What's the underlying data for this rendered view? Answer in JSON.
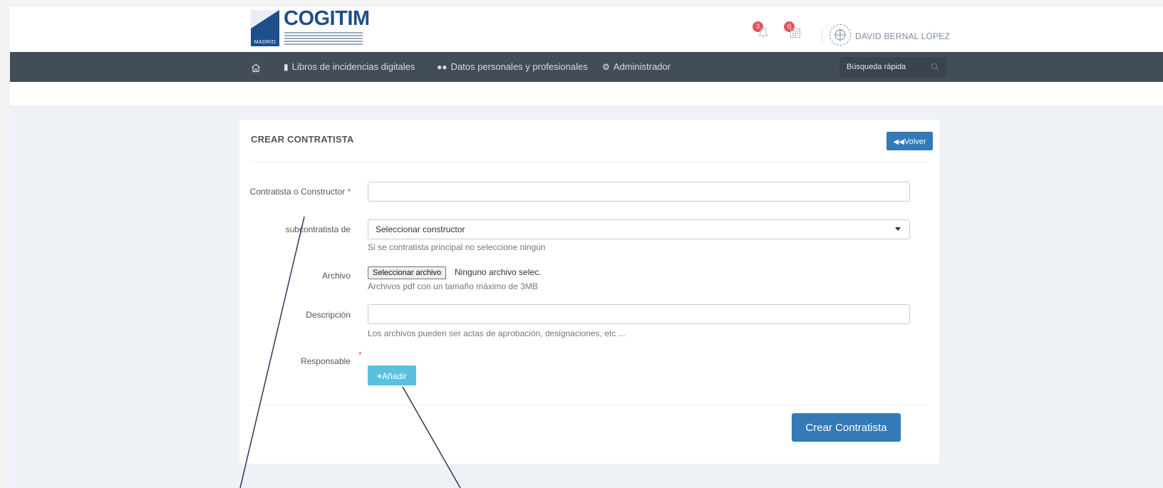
{
  "header": {
    "logo_text": "COGITIM",
    "logo_madrid": "MADRID",
    "notifications_count": "3",
    "calendar_count": "0",
    "user_name": "DAVID BERNAL LÓPEZ"
  },
  "nav": {
    "items": [
      {
        "label": "Libros de incidencias digitales",
        "icon": "book-icon"
      },
      {
        "label": "Datos personales y profesionales",
        "icon": "users-icon"
      },
      {
        "label": "Administrador",
        "icon": "gears-icon"
      }
    ],
    "search_placeholder": "Búsqueda rápida"
  },
  "card": {
    "title": "CREAR CONTRATISTA",
    "back_label": "Volver"
  },
  "form": {
    "contratista_label": "Contratista o Constructor",
    "subcontratista_label": "subcontratista de",
    "subcontratista_value": "Seleccionar constructor",
    "subcontratista_help": "Si se contratista principal no seleccione ningún",
    "archivo_label": "Archivo",
    "archivo_button": "Seleccionar archivo",
    "archivo_status": "Ninguno archivo selec.",
    "archivo_help": "Archivos pdf con un tamaño máximo de 3MB",
    "descripcion_label": "Descripción",
    "descripcion_help": "Los archivos pueden ser actas de aprobación, designaciones, etc ...",
    "responsable_label": "Responsable",
    "add_button": "Añadir",
    "submit_button": "Crear Contratista"
  },
  "colors": {
    "navbar": "#434d5a",
    "primary": "#337ab7",
    "info": "#5bc0de",
    "badge": "#e8505b"
  }
}
